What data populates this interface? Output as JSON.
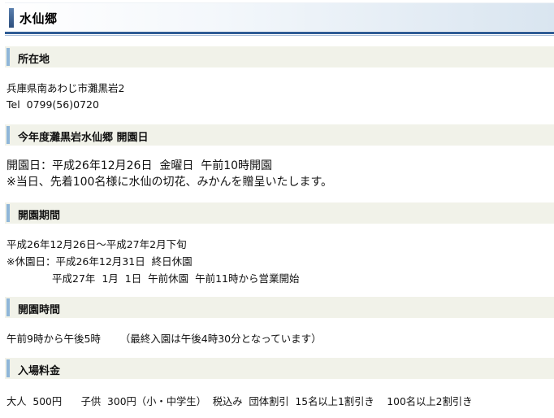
{
  "page_title": "水仙郷",
  "sections": [
    {
      "heading": "所在地",
      "lines": [
        "兵庫県南あわじ市灘黒岩2",
        "Tel  0799(56)0720"
      ]
    },
    {
      "heading": "今年度灘黒岩水仙郷  開園日",
      "lines": [
        "開園日：平成26年12月26日  金曜日  午前10時開園",
        "※当日、先着100名様に水仙の切花、みかんを贈呈いたします。"
      ]
    },
    {
      "heading": "開園期間",
      "lines": [
        "平成26年12月26日～平成27年2月下旬",
        "※休園日：平成26年12月31日  終日休園",
        "平成27年  1月  1日  午前休園  午前11時から営業開始"
      ]
    },
    {
      "heading": "開園時間",
      "lines": [
        "午前9時から午後5時      （最終入園は午後4時30分となっています）"
      ]
    },
    {
      "heading": "入場料金",
      "lines": [
        "大人  500円      子供  300円（小・中学生）  税込み  団体割引  15名以上1割引き    100名以上2割引き"
      ]
    }
  ]
}
